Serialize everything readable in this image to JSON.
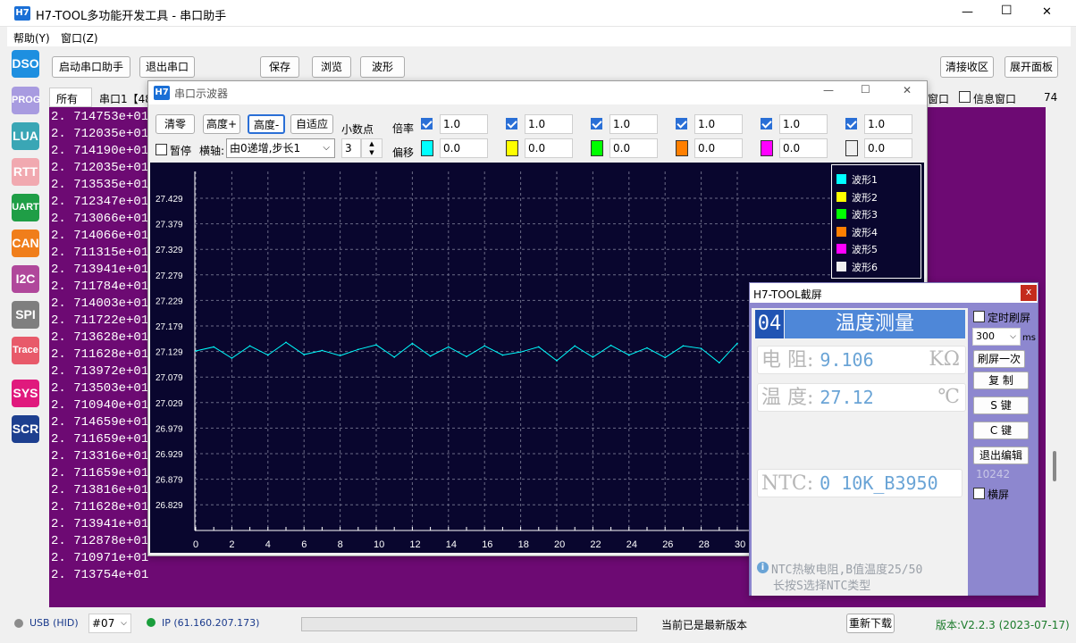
{
  "app": {
    "logo": "H7",
    "title": "H7-TOOL多功能开发工具 - 串口助手",
    "min": "—",
    "max": "☐",
    "close": "✕"
  },
  "menu": {
    "help": "帮助(Y)",
    "window": "窗口(Z)"
  },
  "toolbar": {
    "start": "启动串口助手",
    "exit": "退出串口",
    "save": "保存",
    "browse": "浏览",
    "wave": "波形",
    "clear_recv": "清接收区",
    "expand": "展开面板"
  },
  "sidebar": [
    "DSO",
    "PROG",
    "LUA",
    "RTT",
    "UART",
    "CAN",
    "I2C",
    "SPI",
    "Trace",
    "SYS",
    "SCR"
  ],
  "sidebar_colors": [
    "#1e8fe0",
    "#a89be0",
    "#3aa6b5",
    "#f1a9b0",
    "#1f9e46",
    "#f07e1b",
    "#b0489b",
    "#7f7f7f",
    "#e85a6a",
    "#e0197d",
    "#1d3f8f"
  ],
  "tabs": {
    "all": "所有",
    "port": "串口1【48",
    "win": "窗口",
    "info": "信息窗口",
    "count": "74"
  },
  "log": [
    "2. 714753e+01",
    "2. 712035e+01",
    "2. 714190e+01",
    "2. 712035e+01",
    "2. 713535e+01",
    "2. 712347e+01",
    "2. 713066e+01",
    "2. 714066e+01",
    "2. 711315e+01",
    "2. 713941e+01",
    "2. 711784e+01",
    "2. 714003e+01",
    "2. 711722e+01",
    "2. 713628e+01",
    "2. 711628e+01",
    "2. 713972e+01",
    "2. 713503e+01",
    "2. 710940e+01",
    "2. 714659e+01",
    "2. 711659e+01",
    "2. 713316e+01",
    "2. 711659e+01",
    "2. 713816e+01",
    "2. 711628e+01",
    "2. 713941e+01",
    "2. 712878e+01",
    "2. 710971e+01",
    "2. 713754e+01"
  ],
  "osc": {
    "logo": "H7",
    "title": "串口示波器",
    "clear": "清零",
    "hplus": "高度+",
    "hminus": "高度-",
    "auto": "自适应",
    "decimal_label": "小数点",
    "decimal_value": "3",
    "pause": "暂停",
    "axis_label": "横轴:",
    "axis_value": "由0递增,步长1",
    "scale_label": "倍率",
    "offset_label": "偏移",
    "channels": [
      {
        "color": "#00ffff",
        "scale": "1.0",
        "offset": "0.0"
      },
      {
        "color": "#ffff00",
        "scale": "1.0",
        "offset": "0.0"
      },
      {
        "color": "#00ff00",
        "scale": "1.0",
        "offset": "0.0"
      },
      {
        "color": "#ff7f00",
        "scale": "1.0",
        "offset": "0.0"
      },
      {
        "color": "#ff00ff",
        "scale": "1.0",
        "offset": "0.0"
      },
      {
        "color": "#f0f0f0",
        "scale": "1.0",
        "offset": "0.0"
      }
    ]
  },
  "chart_data": {
    "type": "line",
    "y_ticks": [
      "27.429",
      "27.379",
      "27.329",
      "27.279",
      "27.229",
      "27.179",
      "27.129",
      "27.079",
      "27.029",
      "26.979",
      "26.929",
      "26.879",
      "26.829"
    ],
    "x_ticks": [
      "0",
      "2",
      "4",
      "6",
      "8",
      "10",
      "12",
      "14",
      "16",
      "18",
      "20",
      "22",
      "24",
      "26",
      "28",
      "30"
    ],
    "ylim": [
      26.829,
      27.429
    ],
    "series": [
      {
        "name": "波形1",
        "color": "#00ffff",
        "x": [
          0,
          1,
          2,
          3,
          4,
          5,
          6,
          7,
          8,
          9,
          10,
          11,
          12,
          13,
          14,
          15,
          16,
          17,
          18,
          19,
          20,
          21,
          22,
          23,
          24,
          25,
          26,
          27,
          28,
          29,
          30
        ],
        "values": [
          27.13,
          27.138,
          27.116,
          27.14,
          27.122,
          27.147,
          27.123,
          27.131,
          27.121,
          27.133,
          27.142,
          27.118,
          27.145,
          27.12,
          27.138,
          27.119,
          27.14,
          27.122,
          27.128,
          27.138,
          27.111,
          27.14,
          27.118,
          27.141,
          27.122,
          27.136,
          27.117,
          27.14,
          27.135,
          27.107,
          27.145
        ]
      }
    ],
    "legend": [
      "波形1",
      "波形2",
      "波形3",
      "波形4",
      "波形5",
      "波形6"
    ],
    "legend_colors": [
      "#00ffff",
      "#ffff00",
      "#00ff00",
      "#ff7f00",
      "#ff00ff",
      "#f0f0f0"
    ]
  },
  "screen": {
    "title": "H7-TOOL截屏",
    "close": "x",
    "page_num": "04",
    "heading": "温度测量",
    "r_label": "电 阻:",
    "r_value": "9.106",
    "r_unit": "KΩ",
    "t_label": "温 度:",
    "t_value": "27.12",
    "t_unit": "℃",
    "ntc_label": "NTC:",
    "ntc_value": "0 10K_B3950",
    "note1": "NTC热敏电阻,B值温度25/50",
    "note2": "长按S选择NTC类型",
    "timed": "定时刷屏",
    "interval": "300",
    "ms": "ms",
    "refresh": "刷屏一次",
    "copy": "复 制",
    "skey": "S 键",
    "ckey": "C 键",
    "exit_edit": "退出编辑",
    "num": "10242",
    "landscape": "横屏"
  },
  "status": {
    "usb": "USB (HID)",
    "port": "#07",
    "ip": "IP (61.160.207.173)",
    "latest": "当前已是最新版本",
    "redownload": "重新下载",
    "version": "版本:V2.2.3 (2023-07-17)"
  }
}
